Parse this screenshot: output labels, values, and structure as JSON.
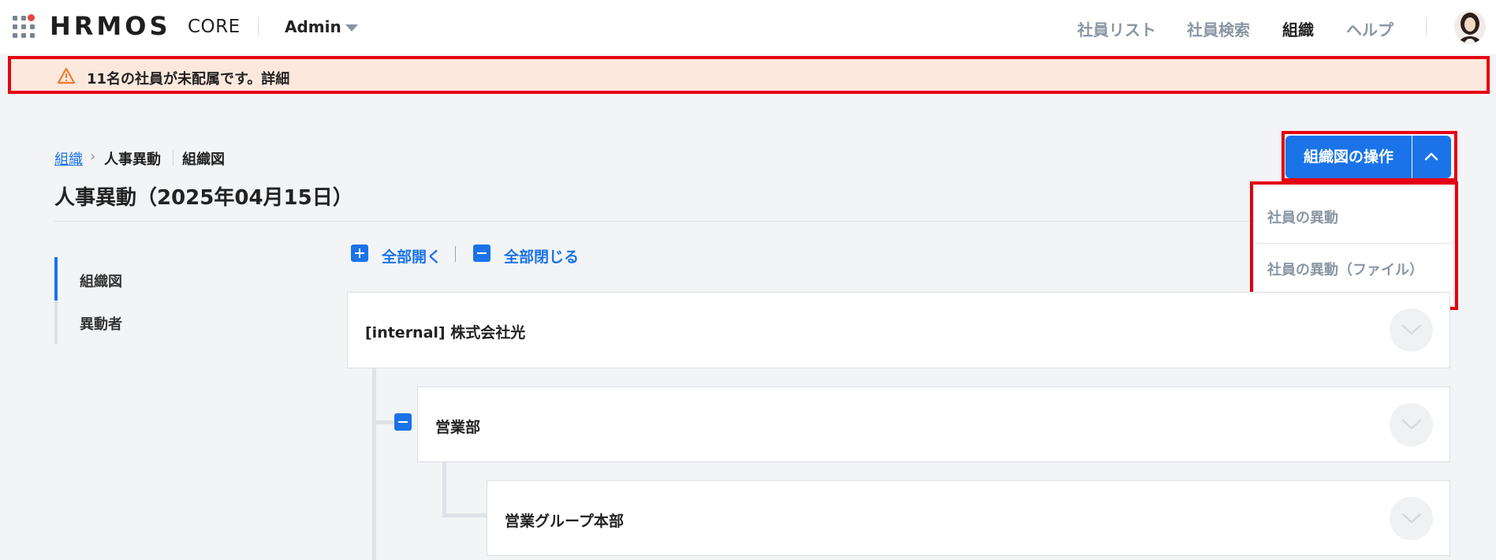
{
  "header": {
    "logo": "HRMOS",
    "logo_sub": "CORE",
    "role": "Admin",
    "nav": [
      "社員リスト",
      "社員検索",
      "組織",
      "ヘルプ"
    ],
    "active_nav": "組織"
  },
  "alert": {
    "text": "11名の社員が未配属です。詳細"
  },
  "breadcrumb": {
    "root": "組織",
    "current": "人事異動",
    "sub": "組織図"
  },
  "page_title": "人事異動（2025年04月15日）",
  "actions": {
    "button_label": "組織図の操作",
    "menu": [
      "社員の異動",
      "社員の異動（ファイル）"
    ]
  },
  "side_nav": {
    "items": [
      "組織図",
      "異動者"
    ],
    "active": "組織図"
  },
  "tree_controls": {
    "expand_all": "全部開く",
    "collapse_all": "全部閉じる"
  },
  "tree": {
    "nodes": [
      "[internal] 株式会社光",
      "営業部",
      "営業グループ本部"
    ]
  },
  "colors": {
    "accent": "#1a73e8",
    "alert_bg": "#fde8de",
    "highlight": "#e60012"
  }
}
